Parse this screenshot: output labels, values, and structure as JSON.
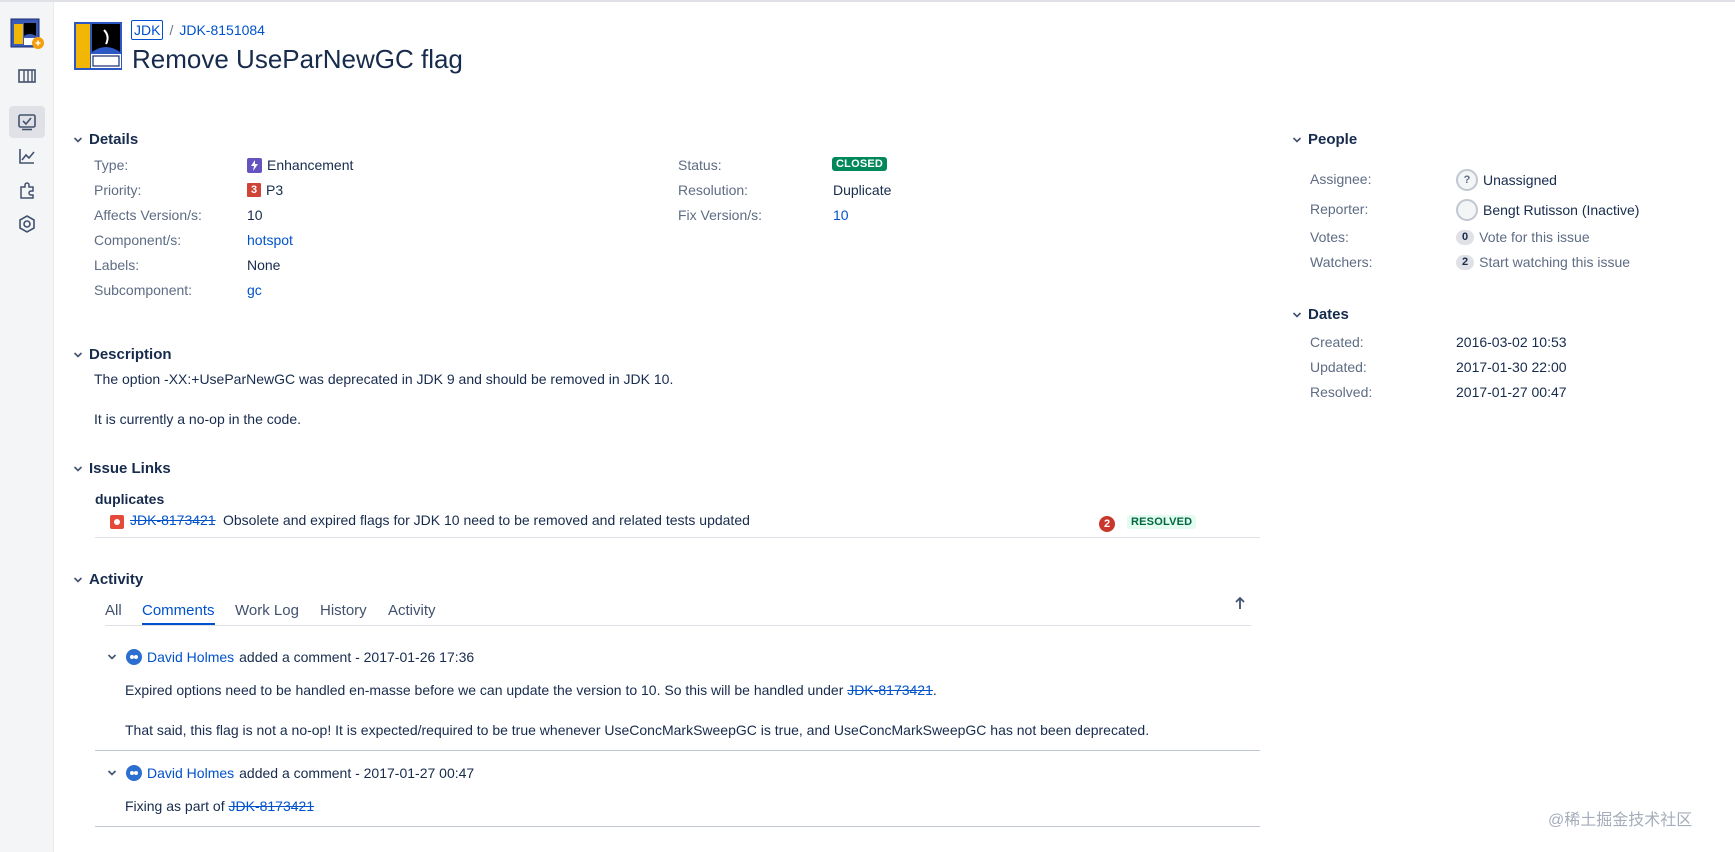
{
  "breadcrumbs": {
    "project": "JDK",
    "separator": "/",
    "issue_key": "JDK-8151084"
  },
  "issue": {
    "title": "Remove UseParNewGC flag"
  },
  "sidebar": {
    "icons": [
      "project-avatar-icon",
      "board-icon",
      "issues-icon",
      "reports-icon",
      "addons-icon",
      "settings-icon"
    ]
  },
  "details": {
    "heading": "Details",
    "left": [
      {
        "label": "Type:",
        "value": "Enhancement"
      },
      {
        "label": "Priority:",
        "value": "P3",
        "priority_number": "3"
      },
      {
        "label": "Affects Version/s:",
        "value": "10"
      },
      {
        "label": "Component/s:",
        "value": "hotspot"
      },
      {
        "label": "Labels:",
        "value": "None"
      },
      {
        "label": "Subcomponent:",
        "value": "gc"
      }
    ],
    "right": [
      {
        "label": "Status:",
        "value": "CLOSED"
      },
      {
        "label": "Resolution:",
        "value": "Duplicate"
      },
      {
        "label": "Fix Version/s:",
        "value": "10"
      }
    ]
  },
  "description": {
    "heading": "Description",
    "lines": [
      "The option -XX:+UseParNewGC was deprecated in JDK 9 and should be removed in JDK 10.",
      "It is currently a no-op in the code."
    ]
  },
  "issue_links": {
    "heading": "Issue Links",
    "type": "duplicates",
    "items": [
      {
        "key": "JDK-8173421",
        "summary": "Obsolete and expired flags for JDK 10 need to be removed and related tests updated",
        "priority": "2",
        "status": "RESOLVED"
      }
    ]
  },
  "activity": {
    "heading": "Activity",
    "tabs": [
      "All",
      "Comments",
      "Work Log",
      "History",
      "Activity"
    ],
    "active_tab": "Comments",
    "comments": [
      {
        "author": "David Holmes",
        "action": "added a comment - 2017-01-26 17:36",
        "body": [
          {
            "text": "Expired options need to be handled en-masse before we can update the version to 10. So this will be handled under ",
            "link": "JDK-8173421",
            "after": "."
          },
          {
            "text": "That said, this flag is not a no-op! It is expected/required to be true whenever UseConcMarkSweepGC is true, and UseConcMarkSweepGC has not been deprecated."
          }
        ]
      },
      {
        "author": "David Holmes",
        "action": "added a comment - 2017-01-27 00:47",
        "body": [
          {
            "text": "Fixing as part of ",
            "link": "JDK-8173421"
          }
        ]
      }
    ]
  },
  "people": {
    "heading": "People",
    "rows": [
      {
        "label": "Assignee:",
        "value": "Unassigned",
        "avatar": "?"
      },
      {
        "label": "Reporter:",
        "value": "Bengt Rutisson (Inactive)"
      },
      {
        "label": "Votes:",
        "count": "0",
        "value": "Vote for this issue"
      },
      {
        "label": "Watchers:",
        "count": "2",
        "value": "Start watching this issue"
      }
    ]
  },
  "dates": {
    "heading": "Dates",
    "rows": [
      {
        "label": "Created:",
        "value": "2016-03-02 10:53"
      },
      {
        "label": "Updated:",
        "value": "2017-01-30 22:00"
      },
      {
        "label": "Resolved:",
        "value": "2017-01-27 00:47"
      }
    ]
  },
  "watermark": "@稀土掘金技术社区",
  "colors": {
    "link": "#0052cc",
    "closed": "#00875a",
    "resolved_bg": "#e3fcef",
    "priority": "#d04437"
  }
}
